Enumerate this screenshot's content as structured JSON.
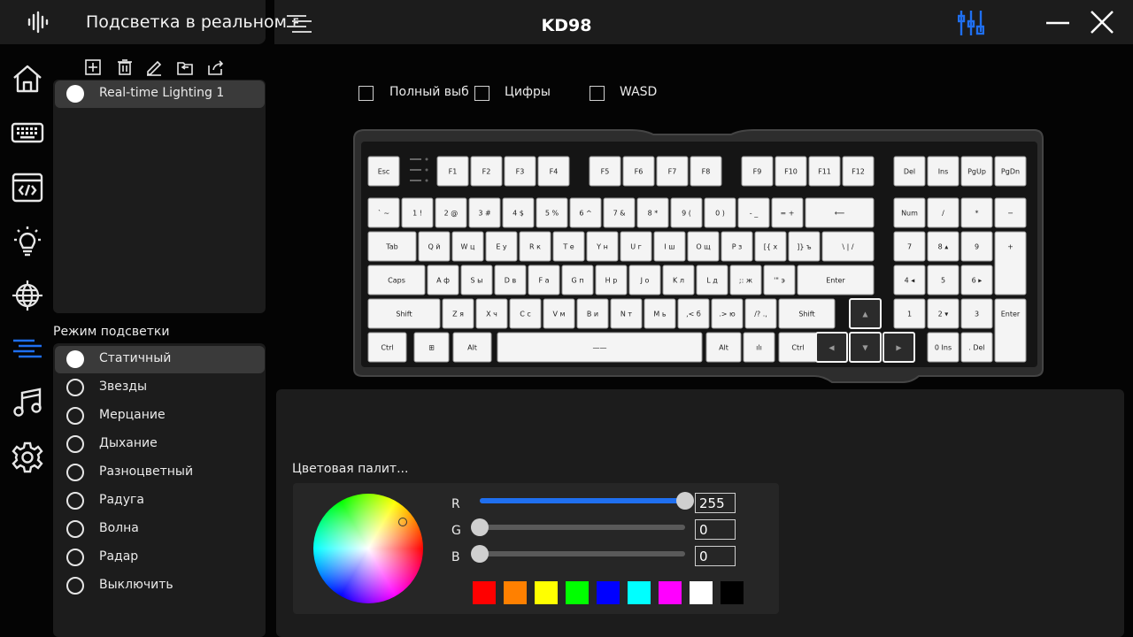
{
  "header": {
    "page_title": "Подсветка в реальном вр...",
    "device_name": "KD98"
  },
  "profiles": {
    "items": [
      {
        "label": "Real-time Lighting 1",
        "selected": true
      }
    ]
  },
  "lighting_modes": {
    "title": "Режим подсветки",
    "items": [
      {
        "label": "Статичный",
        "selected": true
      },
      {
        "label": "Звезды",
        "selected": false
      },
      {
        "label": "Мерцание",
        "selected": false
      },
      {
        "label": "Дыхание",
        "selected": false
      },
      {
        "label": "Разноцветный",
        "selected": false
      },
      {
        "label": "Радуга",
        "selected": false
      },
      {
        "label": "Волна",
        "selected": false
      },
      {
        "label": "Радар",
        "selected": false
      },
      {
        "label": "Выключить",
        "selected": false
      }
    ]
  },
  "key_selection": {
    "options": [
      {
        "label": "Полный выб",
        "checked": false
      },
      {
        "label": "Цифры",
        "checked": false
      },
      {
        "label": "WASD",
        "checked": false
      }
    ]
  },
  "keyboard": {
    "rows": [
      [
        "Esc",
        "F1",
        "F2",
        "F3",
        "F4",
        "F5",
        "F6",
        "F7",
        "F8",
        "F9",
        "F10",
        "F11",
        "F12",
        "Del",
        "Ins",
        "PgUp",
        "PgDn"
      ],
      [
        "` ~",
        "1 !",
        "2 @",
        "3 #",
        "4 $",
        "5 %",
        "6 ^",
        "7 &",
        "8 *",
        "9 (",
        "0 )",
        "- _",
        "= +",
        "⟵",
        "Num",
        "/",
        "*",
        "−"
      ],
      [
        "Tab",
        "Q й",
        "W ц",
        "E у",
        "R к",
        "T е",
        "Y н",
        "U г",
        "I ш",
        "O щ",
        "P з",
        "[{ х",
        "]} ъ",
        "\\ | /",
        "7",
        "8 ▴",
        "9",
        "+"
      ],
      [
        "Caps",
        "A ф",
        "S ы",
        "D в",
        "F а",
        "G п",
        "H р",
        "J о",
        "K л",
        "L д",
        ";: ж",
        "'\" э",
        "Enter",
        "4 ◂",
        "5",
        "6 ▸"
      ],
      [
        "Shift",
        "Z я",
        "X ч",
        "C с",
        "V м",
        "B и",
        "N т",
        "M ь",
        ",< б",
        ".> ю",
        "/? .,",
        "Shift",
        "▲",
        "1",
        "2 ▾",
        "3",
        "Enter"
      ],
      [
        "Ctrl",
        "⊞",
        "Alt",
        "——",
        "Alt",
        "ılı",
        "Ctrl",
        "◀",
        "▼",
        "▶",
        "0 Ins",
        ". Del"
      ]
    ]
  },
  "color_palette": {
    "title": "Цветовая палит...",
    "channels": [
      {
        "label": "R",
        "value": "255",
        "level": 255
      },
      {
        "label": "G",
        "value": "0",
        "level": 0
      },
      {
        "label": "B",
        "value": "0",
        "level": 0
      }
    ],
    "swatches": [
      "#ff0000",
      "#ff8000",
      "#ffff00",
      "#00ff00",
      "#0000ff",
      "#00ffff",
      "#ff00ff",
      "#ffffff",
      "#000000"
    ]
  },
  "icons": {
    "sidebar": [
      "home-icon",
      "keyboard-icon",
      "macro-icon",
      "lighting-icon",
      "globe-icon",
      "realtime-lighting-icon",
      "music-icon",
      "settings-icon"
    ],
    "profile_tools": [
      "add-icon",
      "delete-icon",
      "edit-icon",
      "import-icon",
      "export-icon"
    ]
  },
  "colors": {
    "accent": "#1f6ff0",
    "panel": "#1c1c1c",
    "selected": "#3a3a3a"
  }
}
